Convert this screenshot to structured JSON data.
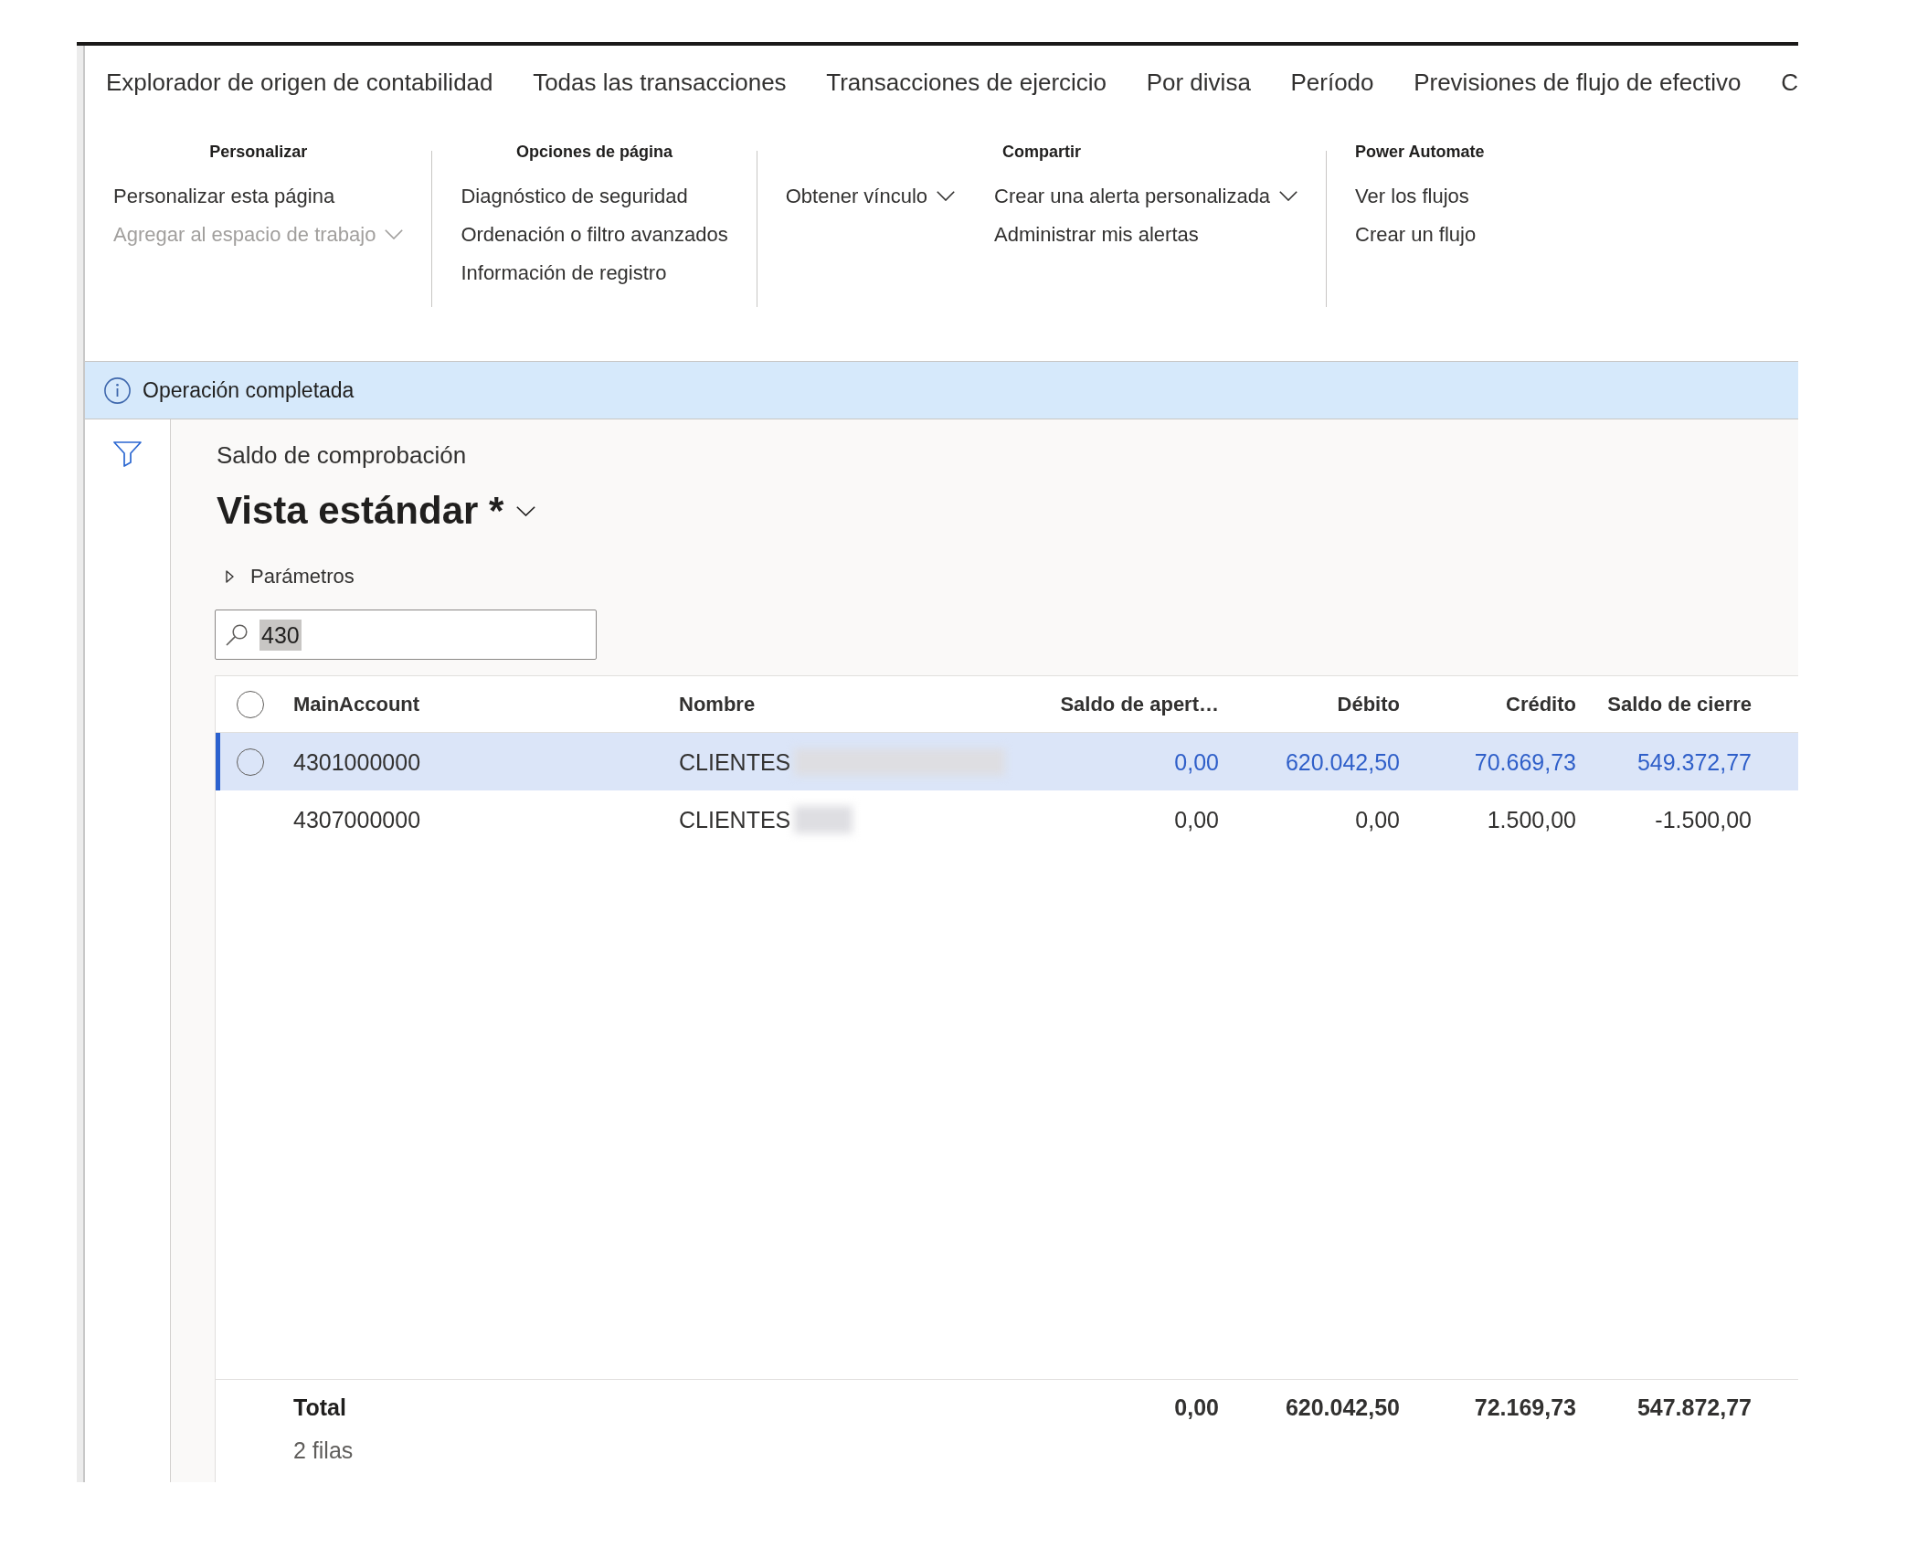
{
  "tabs": [
    {
      "label": "Explorador de origen de contabilidad",
      "selected": false
    },
    {
      "label": "Todas las transacciones",
      "selected": false
    },
    {
      "label": "Transacciones de ejercicio",
      "selected": false
    },
    {
      "label": "Por divisa",
      "selected": false
    },
    {
      "label": "Período",
      "selected": false
    },
    {
      "label": "Previsiones de flujo de efectivo",
      "selected": false
    },
    {
      "label": "C",
      "selected": false
    }
  ],
  "ribbon": {
    "groups": [
      {
        "title": "Personalizar",
        "columns": [
          [
            {
              "label": "Personalizar esta página",
              "disabled": false,
              "dropdown": false
            },
            {
              "label": "Agregar al espacio de trabajo",
              "disabled": true,
              "dropdown": true
            }
          ]
        ]
      },
      {
        "title": "Opciones de página",
        "columns": [
          [
            {
              "label": "Diagnóstico de seguridad",
              "disabled": false,
              "dropdown": false
            },
            {
              "label": "Ordenación o filtro avanzados",
              "disabled": false,
              "dropdown": false
            },
            {
              "label": "Información de registro",
              "disabled": false,
              "dropdown": false
            }
          ]
        ]
      },
      {
        "title": "Compartir",
        "columns": [
          [
            {
              "label": "Obtener vínculo",
              "disabled": false,
              "dropdown": true
            }
          ],
          [
            {
              "label": "Crear una alerta personalizada",
              "disabled": false,
              "dropdown": true
            },
            {
              "label": "Administrar mis alertas",
              "disabled": false,
              "dropdown": false
            }
          ]
        ]
      },
      {
        "title": "Power Automate",
        "columns": [
          [
            {
              "label": "Ver los flujos",
              "disabled": false,
              "dropdown": false
            },
            {
              "label": "Crear un flujo",
              "disabled": false,
              "dropdown": false
            }
          ]
        ]
      }
    ]
  },
  "message_bar": {
    "kind": "info",
    "text": "Operación completada"
  },
  "page": {
    "caption": "Saldo de comprobación",
    "view_title": "Vista estándar *",
    "parameters": {
      "label": "Parámetros",
      "expanded": false
    },
    "search": {
      "value": "430",
      "text_selected": true
    }
  },
  "grid": {
    "select_all": {
      "checked": false
    },
    "columns": [
      {
        "label": "MainAccount",
        "kind": "text"
      },
      {
        "label": "Nombre",
        "kind": "text"
      },
      {
        "label": "Saldo de apert…",
        "kind": "amount"
      },
      {
        "label": "Débito",
        "kind": "amount"
      },
      {
        "label": "Crédito",
        "kind": "amount"
      },
      {
        "label": "Saldo de cierre",
        "kind": "amount"
      }
    ],
    "rows": [
      {
        "kind": "wide",
        "selected": true,
        "checked": false,
        "cells": [
          "4301000000",
          "CLIENTES",
          "0,00",
          "620.042,50",
          "70.669,73",
          "549.372,77"
        ]
      },
      {
        "kind": "narrow",
        "selected": false,
        "checked": false,
        "cells": [
          "4307000000",
          "CLIENTES",
          "0,00",
          "0,00",
          "1.500,00",
          "-1.500,00"
        ]
      }
    ],
    "footer": {
      "label": "Total",
      "cells": [
        "0,00",
        "620.042,50",
        "72.169,73",
        "547.872,77"
      ],
      "row_count": "2 filas"
    }
  }
}
